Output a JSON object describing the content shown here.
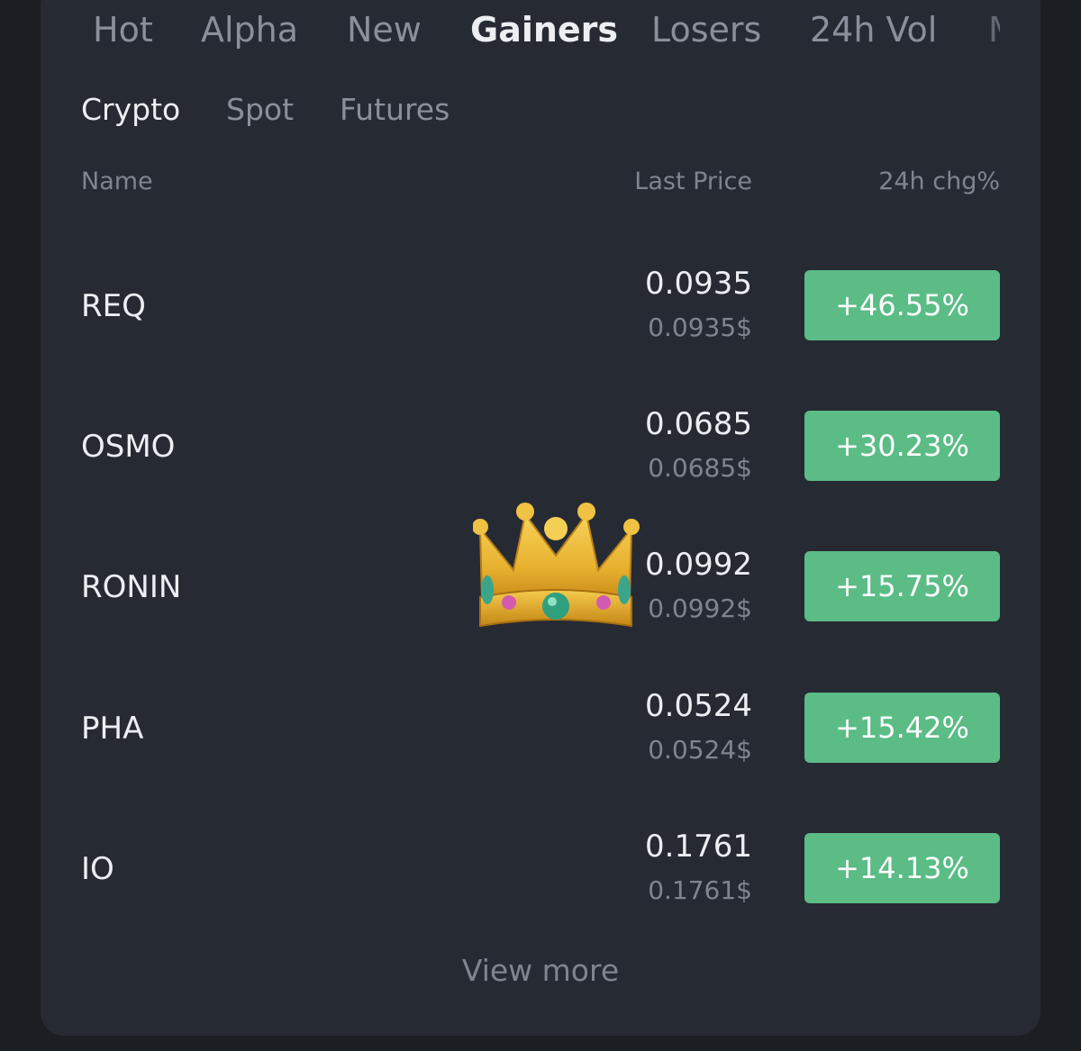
{
  "tabs": [
    {
      "label": "Hot"
    },
    {
      "label": "Alpha"
    },
    {
      "label": "New"
    },
    {
      "label": "Gainers",
      "active": true
    },
    {
      "label": "Losers"
    },
    {
      "label": "24h Vol"
    }
  ],
  "subtabs": [
    {
      "label": "Crypto",
      "active": true
    },
    {
      "label": "Spot"
    },
    {
      "label": "Futures"
    }
  ],
  "columns": {
    "name": "Name",
    "last_price": "Last Price",
    "change": "24h chg%"
  },
  "rows": [
    {
      "symbol": "REQ",
      "price": "0.0935",
      "usd": "0.0935$",
      "change": "+46.55%"
    },
    {
      "symbol": "OSMO",
      "price": "0.0685",
      "usd": "0.0685$",
      "change": "+30.23%"
    },
    {
      "symbol": "RONIN",
      "price": "0.0992",
      "usd": "0.0992$",
      "change": "+15.75%"
    },
    {
      "symbol": "PHA",
      "price": "0.0524",
      "usd": "0.0524$",
      "change": "+15.42%"
    },
    {
      "symbol": "IO",
      "price": "0.1761",
      "usd": "0.1761$",
      "change": "+14.13%"
    }
  ],
  "view_more": "View more",
  "overlay": {
    "icon": "crown-icon"
  },
  "colors": {
    "background": "#1b1e23",
    "panel": "#262a33",
    "positive": "#5bbc86",
    "text_primary": "#eceef2",
    "text_muted": "#7f8590"
  }
}
